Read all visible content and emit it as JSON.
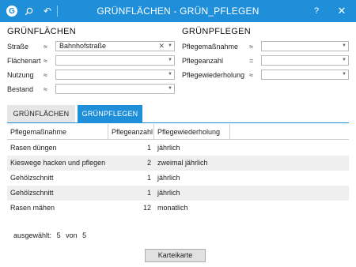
{
  "window": {
    "title": "GRÜNFLÄCHEN - GRÜN_PFLEGEN",
    "logo_letter": "G",
    "help_label": "?",
    "close_label": "✕"
  },
  "filters_left": {
    "title": "GRÜNFLÄCHEN",
    "fields": [
      {
        "label": "Straße",
        "op": "≈",
        "value": "Bahnhofstraße"
      },
      {
        "label": "Flächenart",
        "op": "≈",
        "value": ""
      },
      {
        "label": "Nutzung",
        "op": "≈",
        "value": ""
      },
      {
        "label": "Bestand",
        "op": "≈",
        "value": ""
      }
    ]
  },
  "filters_right": {
    "title": "GRÜNPFLEGEN",
    "fields": [
      {
        "label": "Pflegemaßnahme",
        "op": "≈",
        "value": ""
      },
      {
        "label": "Pflegeanzahl",
        "op": "=",
        "value": ""
      },
      {
        "label": "Pflegewiederholung",
        "op": "≈",
        "value": ""
      }
    ]
  },
  "tabs": [
    {
      "label": "GRÜNFLÄCHEN",
      "active": false
    },
    {
      "label": "GRÜNPFLEGEN",
      "active": true
    }
  ],
  "table": {
    "columns": [
      "Pflegemaßnahme",
      "Pflegeanzahl",
      "Pflegewiederholung"
    ],
    "rows": [
      {
        "massnahme": "Rasen düngen",
        "anzahl": "1",
        "wiederholung": "jährlich"
      },
      {
        "massnahme": "Kieswege hacken und pflegen",
        "anzahl": "2",
        "wiederholung": "zweimal jährlich"
      },
      {
        "massnahme": "Gehölzschnitt",
        "anzahl": "1",
        "wiederholung": "jährlich"
      },
      {
        "massnahme": "Gehölzschnitt",
        "anzahl": "1",
        "wiederholung": "jährlich"
      },
      {
        "massnahme": "Rasen mähen",
        "anzahl": "12",
        "wiederholung": "monatlich"
      }
    ]
  },
  "status": {
    "label": "ausgewählt:",
    "selected": "5",
    "of_label": "von",
    "total": "5"
  },
  "buttons": {
    "karteikarte": "Karteikarte"
  },
  "icons": {
    "clear": "✕",
    "dropdown": "▼",
    "search": "search-icon",
    "undo": "↶"
  },
  "colors": {
    "accent": "#1e8fd8",
    "row_alt": "#efefef"
  }
}
